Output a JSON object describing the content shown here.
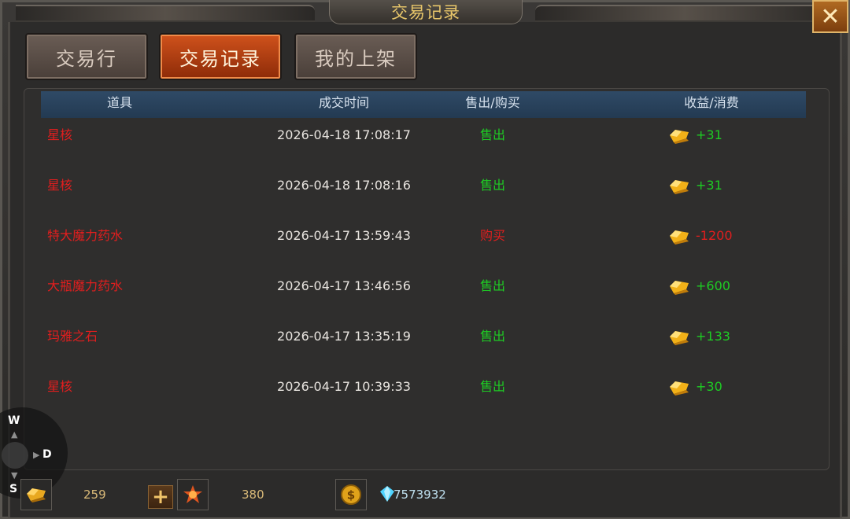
{
  "window": {
    "title": "交易记录",
    "close_label": "✕"
  },
  "tabs": [
    {
      "label": "交易行",
      "active": false
    },
    {
      "label": "交易记录",
      "active": true
    },
    {
      "label": "我的上架",
      "active": false
    }
  ],
  "table": {
    "headers": {
      "item": "道具",
      "time": "成交时间",
      "type": "售出/购买",
      "amount": "收益/消费"
    },
    "rows": [
      {
        "item": "星核",
        "time": "2026-04-18 17:08:17",
        "type": "售出",
        "amount": "+31",
        "kind": "sell"
      },
      {
        "item": "星核",
        "time": "2026-04-18 17:08:16",
        "type": "售出",
        "amount": "+31",
        "kind": "sell"
      },
      {
        "item": "特大魔力药水",
        "time": "2026-04-17 13:59:43",
        "type": "购买",
        "amount": "-1200",
        "kind": "buy"
      },
      {
        "item": "大瓶魔力药水",
        "time": "2026-04-17 13:46:56",
        "type": "售出",
        "amount": "+600",
        "kind": "sell"
      },
      {
        "item": "玛雅之石",
        "time": "2026-04-17 13:35:19",
        "type": "售出",
        "amount": "+133",
        "kind": "sell"
      },
      {
        "item": "星核",
        "time": "2026-04-17 10:39:33",
        "type": "售出",
        "amount": "+30",
        "kind": "sell"
      }
    ]
  },
  "compass": {
    "w": "W",
    "d": "D",
    "s": "S"
  },
  "currencies": {
    "gold_ingot": "259",
    "gem": "380",
    "diamond": "7573932"
  },
  "colors": {
    "sell": "#1ecc24",
    "buy": "#e11e1e",
    "item_name": "#e11e1e",
    "title": "#e8c66a"
  }
}
